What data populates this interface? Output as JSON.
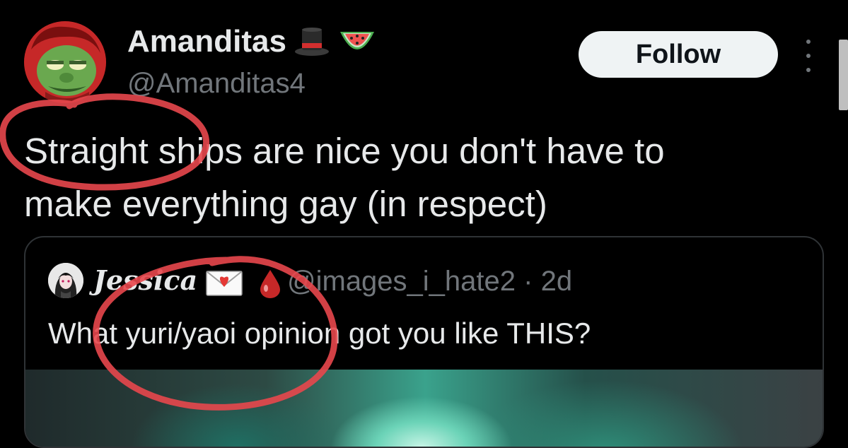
{
  "author": {
    "display_name": "Amanditas",
    "handle": "@Amanditas4",
    "emoji_icons": [
      "top-hat-icon",
      "watermelon-icon"
    ]
  },
  "actions": {
    "follow_label": "Follow",
    "more_icon": "more-vertical-icon"
  },
  "tweet": {
    "line1": "Straight ships are nice you don't have to",
    "line2": "make everything gay (in respect)"
  },
  "quote": {
    "author_name": "Jessica",
    "emoji_icons": [
      "love-letter-icon",
      "drop-of-blood-icon"
    ],
    "handle_time": "@images_i_hate2 · 2d",
    "text": "What yuri/yaoi opinion got you like THIS?"
  },
  "colors": {
    "background": "#000000",
    "text_primary": "#e7e9ea",
    "text_secondary": "#71767b",
    "button_bg": "#eff3f4",
    "annotation_red": "#e8474c"
  }
}
